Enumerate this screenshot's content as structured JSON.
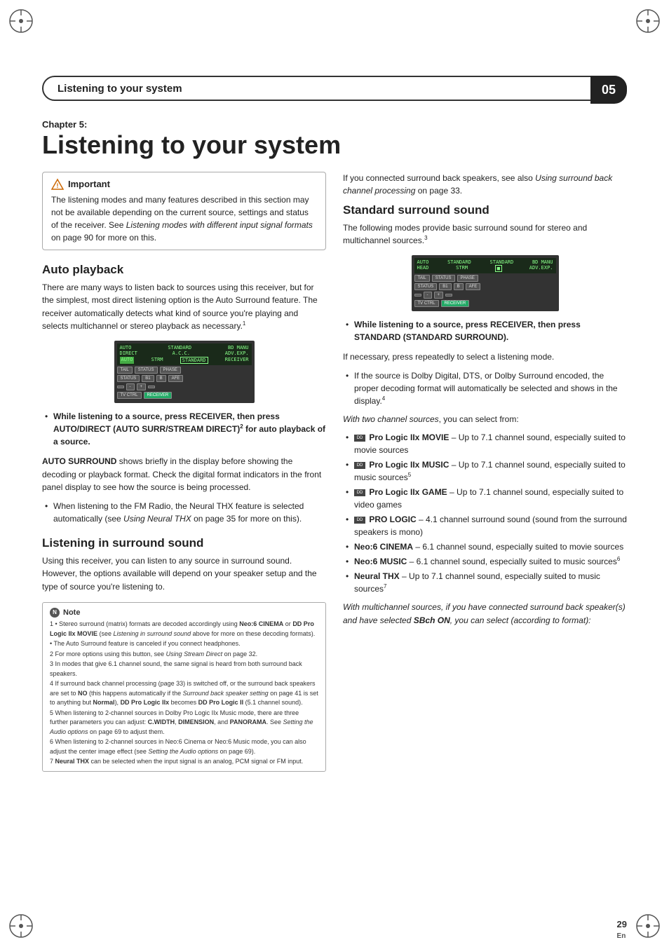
{
  "header": {
    "title": "Listening to your system",
    "chapter_num": "05"
  },
  "chapter": {
    "label": "Chapter 5:",
    "main_title": "Listening to your system"
  },
  "important": {
    "heading": "Important",
    "text": "The listening modes and many features described in this section may not be available depending on the current source, settings and status of the receiver. See Listening modes with different input signal formats on page 90 for more on this."
  },
  "right_intro": "If you connected surround back speakers, see also Using surround back channel processing on page 33.",
  "sections": {
    "auto_playback": {
      "heading": "Auto playback",
      "text1": "There are many ways to listen back to sources using this receiver, but for the simplest, most direct listening option is the Auto Surround feature. The receiver automatically detects what kind of source you're playing and selects multichannel or stereo playback as necessary.",
      "footnote_ref": "1",
      "bullet_heading": "While listening to a source, press RECEIVER, then press AUTO/DIRECT (AUTO SURR/STREAM DIRECT)",
      "footnote_ref2": "2",
      "bullet_tail": "for auto playback of a source.",
      "auto_surround_label": "AUTO SURROUND",
      "auto_surround_text": "shows briefly in the display before showing the decoding or playback format. Check the digital format indicators in the front panel display to see how the source is being processed.",
      "fm_note": "When listening to the FM Radio, the Neural THX feature is selected automatically (see Using Neural THX on page 35 for more on this)."
    },
    "listening_surround": {
      "heading": "Listening in surround sound",
      "text": "Using this receiver, you can listen to any source in surround sound. However, the options available will depend on your speaker setup and the type of source you're listening to."
    },
    "standard_surround": {
      "heading": "Standard surround sound",
      "text": "The following modes provide basic surround sound for stereo and multichannel sources.",
      "footnote_ref": "3",
      "press_instruction": "While listening to a source, press RECEIVER, then press STANDARD (STANDARD SURROUND).",
      "press_note": "If necessary, press repeatedly to select a listening mode.",
      "sub_note": "If the source is Dolby Digital, DTS, or Dolby Surround encoded, the proper decoding format will automatically be selected and shows in the display.",
      "footnote_ref4": "4",
      "two_channel_label": "With two channel sources, you can select from:"
    },
    "modes": [
      {
        "icon": "DD",
        "label": "Pro Logic IIx MOVIE",
        "desc": "– Up to 7.1 channel sound, especially suited to movie sources"
      },
      {
        "icon": "DD",
        "label": "Pro Logic IIx MUSIC",
        "desc": "– Up to 7.1 channel sound, especially suited to music sources",
        "footnote": "5"
      },
      {
        "icon": "DD",
        "label": "Pro Logic IIx GAME",
        "desc": "– Up to 7.1 channel sound, especially suited to video games"
      },
      {
        "icon": "DD",
        "label": "PRO LOGIC",
        "desc": "– 4.1 channel surround sound (sound from the surround speakers is mono)"
      },
      {
        "icon": "",
        "label": "Neo:6 CINEMA",
        "desc": "– 6.1 channel sound, especially suited to movie sources"
      },
      {
        "icon": "",
        "label": "Neo:6 MUSIC",
        "desc": "– 6.1 channel sound, especially suited to music sources",
        "footnote": "6"
      },
      {
        "icon": "",
        "label": "Neural THX",
        "desc": "– Up to 7.1 channel sound, especially suited to music sources",
        "footnote": "7"
      }
    ],
    "multichannel_note": "With multichannel sources, if you have connected surround back speaker(s) and have selected SBch ON, you can select (according to format):"
  },
  "note_box": {
    "heading": "Note",
    "lines": [
      "1 • Stereo surround (matrix) formats are decoded accordingly using Neo:6 CINEMA or DD Pro Logic IIx MOVIE (see Listening in surround sound above for more on these decoding formats).",
      "• The Auto Surround feature is canceled if you connect headphones.",
      "2 For more options using this button, see Using Stream Direct on page 32.",
      "3 In modes that give 6.1 channel sound, the same signal is heard from both surround back speakers.",
      "4 If surround back channel processing (page 33) is switched off, or the surround back speakers are set to NO (this happens automatically if the Surround back speaker setting on page 41 is set to anything but Normal), DD Pro Logic IIx becomes DD Pro Logic II (5.1 channel sound).",
      "5 When listening to 2-channel sources in Dolby Pro Logic IIx Music mode, there are three further parameters you can adjust: C.WIDTH, DIMENSION, and PANORAMA. See Setting the Audio options on page 69 to adjust them.",
      "6 When listening to 2-channel sources in Neo:6 Cinema or Neo:6 Music mode, you can also adjust the center image effect (see Setting the Audio options on page 69).",
      "7 Neural THX can be selected when the input signal is an analog, PCM signal or FM input."
    ]
  },
  "page": {
    "number": "29",
    "lang": "En"
  }
}
